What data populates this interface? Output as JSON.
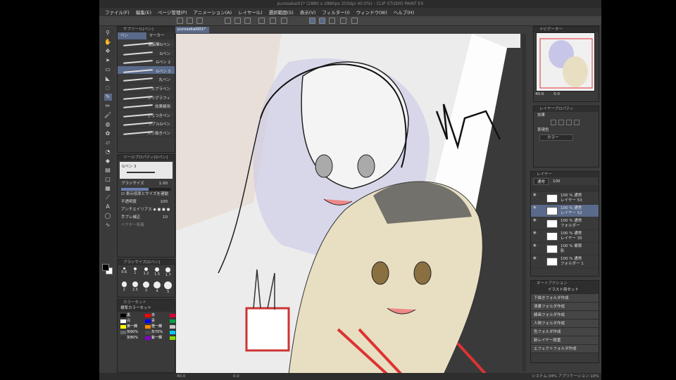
{
  "window": {
    "title": "purosekai01* (2880 x 2880px 350dpi 40.0%) - CLIP STUDIO PAINT EX"
  },
  "menu": [
    "ファイル(F)",
    "編集(E)",
    "ページ管理(P)",
    "アニメーション(A)",
    "レイヤー(L)",
    "選択範囲(S)",
    "表示(V)",
    "フィルター(I)",
    "ウィンドウ(W)",
    "ヘルプ(H)"
  ],
  "document_tab": "purosekai001*",
  "subtool_panel": {
    "header": "サブツール[ペン]",
    "tabs": [
      "ペン",
      "マーカー"
    ],
    "brushes": [
      {
        "label": "濃鉛筆Gペン"
      },
      {
        "label": "Gペン"
      },
      {
        "label": "Gペン 2"
      },
      {
        "label": "Gペン 3",
        "selected": true
      },
      {
        "label": "丸ペン"
      },
      {
        "label": "カブラペン"
      },
      {
        "label": "カリグラフィ"
      },
      {
        "label": "効果線用"
      },
      {
        "label": "ざらつきペン"
      },
      {
        "label": "リアルGペン"
      },
      {
        "label": "入り抜きペン"
      }
    ]
  },
  "tool_property": {
    "header": "ツールプロパティ[Gペン]",
    "brush_name": "Gペン 3",
    "brush_size_label": "ブラシサイズ",
    "brush_size_value": "1.00",
    "brush_size_pct": 55,
    "zoom_link_label": "表示倍率とサイズを連動",
    "opacity_label": "不透明度",
    "opacity_value": "100",
    "antialias_label": "アンチエイリアス",
    "stabilization_label": "手ブレ補正",
    "stabilization_value": "10",
    "vector_label": "ベクター吸着"
  },
  "brush_size_panel": {
    "header": "ブラシサイズ[Gペン]",
    "sizes": [
      "0.6",
      "1",
      "1.2",
      "1.5",
      "1.7",
      "2",
      "2.5",
      "3",
      "4",
      "5"
    ]
  },
  "color_set": {
    "header": "カラーセット",
    "set_name": "標準カラーセット",
    "entries": [
      {
        "label": "黒",
        "color": "#000000"
      },
      {
        "label": "赤",
        "color": "#ff0000"
      },
      {
        "label": "赤一輝",
        "color": "#e00030"
      },
      {
        "label": "白",
        "color": "#ffffff"
      },
      {
        "label": "青",
        "color": "#0000ff"
      },
      {
        "label": "緑一輝",
        "color": "#00a040"
      },
      {
        "label": "黄一輝",
        "color": "#ffff00"
      },
      {
        "label": "橙一輝",
        "color": "#ff8800"
      },
      {
        "label": "透明",
        "color": "#c8c8c8"
      },
      {
        "label": "灰60%",
        "color": "#666666"
      },
      {
        "label": "灰70%",
        "color": "#4d4d4d"
      },
      {
        "label": "水色一輝",
        "color": "#00c8ff"
      },
      {
        "label": "灰80%",
        "color": "#333333"
      },
      {
        "label": "紫一輝",
        "color": "#8800cc"
      },
      {
        "label": "黄緑一輝",
        "color": "#88dd00"
      }
    ]
  },
  "navigator": {
    "header": "ナビゲーター",
    "zoom": "40.0",
    "angle": "0.0"
  },
  "layer_property": {
    "header": "レイヤープロパティ",
    "effect_label": "効果",
    "expression_label": "表現色",
    "expression_value": "カラー"
  },
  "layer_panel": {
    "header": "レイヤー",
    "blend": "通常",
    "opacity": "100",
    "layers": [
      {
        "name": "100 % 通常\nレイヤー 53"
      },
      {
        "name": "100 % 通常\nレイヤー 52",
        "selected": true
      },
      {
        "name": "100 % 通常\nフォルダー"
      },
      {
        "name": "100 % 通常\nレイヤー 35"
      },
      {
        "name": "100 % 乗算\n影"
      },
      {
        "name": "100 % 通常\nフォルダー 1"
      }
    ]
  },
  "auto_action": {
    "header": "オートアクション",
    "set_name": "イラスト用セット",
    "items": [
      "下描きフォルダ作成",
      "清書フォルダ作成",
      "線画フォルダ作成",
      "人物フォルダ作成",
      "色フォルダ作成",
      "新レイヤー設置",
      "エフェクトフォルダ作成"
    ]
  },
  "status": {
    "zoom": "40.0",
    "angle": "0.0",
    "right": "システム:34% アプリケーション:10%"
  },
  "colors": {
    "selected": "#5a6a8a",
    "panel": "#3a3a3a",
    "canvas": "#ececec"
  }
}
